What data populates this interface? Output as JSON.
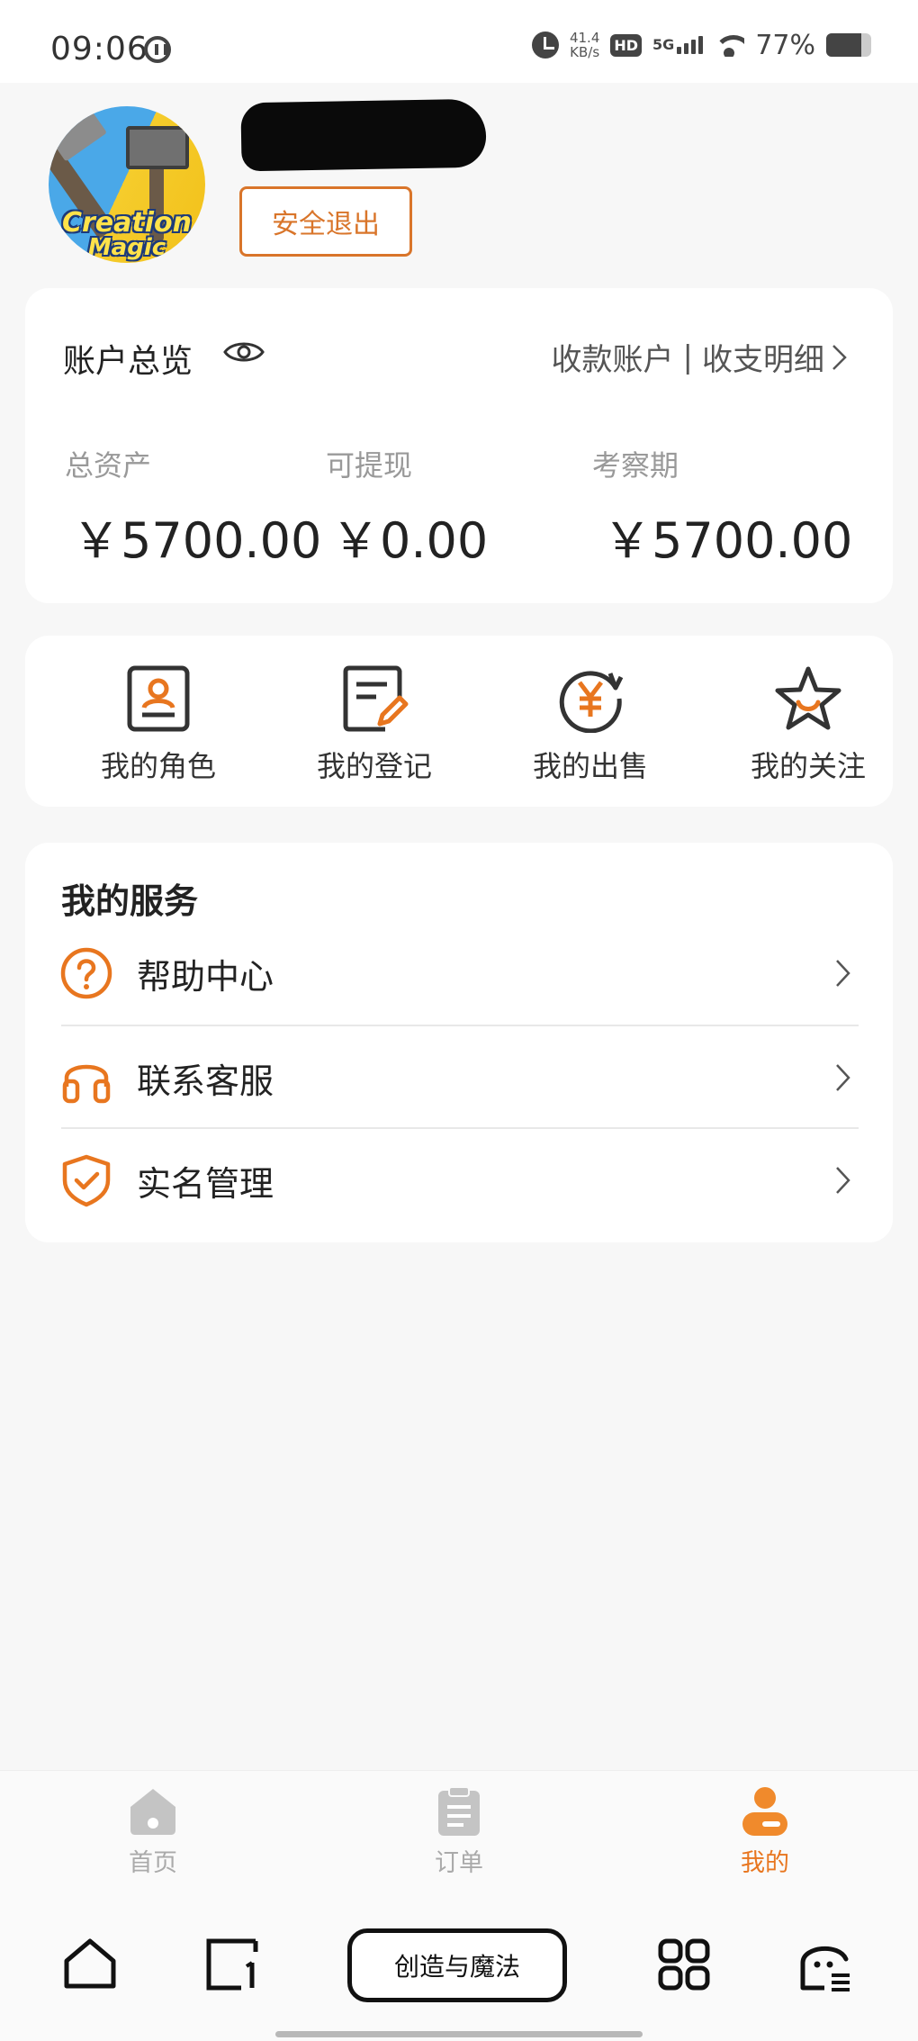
{
  "status_bar": {
    "time": "09:06",
    "net_speed_value": "41.4",
    "net_speed_unit": "KB/s",
    "hd_label": "HD",
    "signal_label": "5G",
    "battery_percent": "77%",
    "battery_level": 0.77
  },
  "profile": {
    "logout_label": "安全退出",
    "avatar_text_line1": "Creation",
    "avatar_text_line2": "Magic"
  },
  "account": {
    "title": "账户总览",
    "link_receive": "收款账户",
    "link_separator": "|",
    "link_details": "收支明细",
    "stats": [
      {
        "label": "总资产",
        "value": "￥5700.00"
      },
      {
        "label": "可提现",
        "value": "￥0.00"
      },
      {
        "label": "考察期",
        "value": "￥5700.00"
      }
    ]
  },
  "quick_actions": [
    {
      "label": "我的角色",
      "icon": "role-card-icon"
    },
    {
      "label": "我的登记",
      "icon": "register-edit-icon"
    },
    {
      "label": "我的出售",
      "icon": "yen-sale-icon"
    },
    {
      "label": "我的关注",
      "icon": "star-icon"
    }
  ],
  "services": {
    "title": "我的服务",
    "items": [
      {
        "label": "帮助中心",
        "icon": "help-icon"
      },
      {
        "label": "联系客服",
        "icon": "headset-icon"
      },
      {
        "label": "实名管理",
        "icon": "shield-check-icon"
      }
    ]
  },
  "tab_bar": {
    "items": [
      {
        "label": "首页",
        "icon": "home-icon",
        "active": false
      },
      {
        "label": "订单",
        "icon": "orders-icon",
        "active": false
      },
      {
        "label": "我的",
        "icon": "profile-icon",
        "active": true
      }
    ],
    "active_color": "#e8761f",
    "inactive_color": "#aaaaaa"
  },
  "system_nav": {
    "center_label": "创造与魔法"
  },
  "colors": {
    "accent": "#d9752a",
    "background": "#f7f7f7",
    "card": "#ffffff"
  }
}
